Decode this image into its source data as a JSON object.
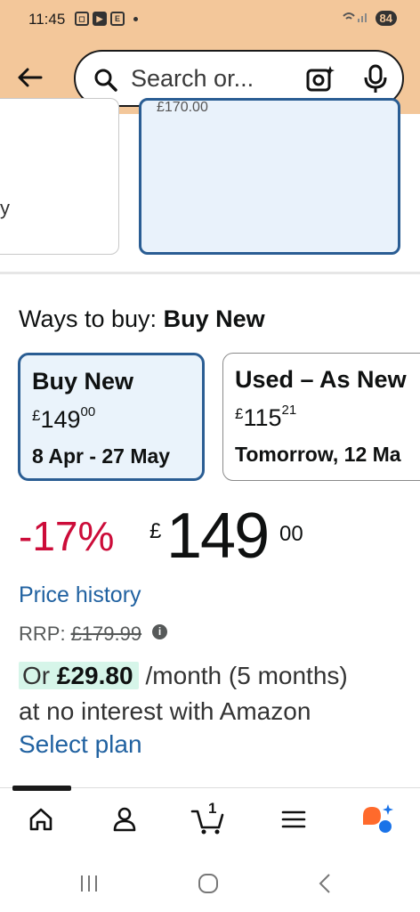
{
  "status_bar": {
    "time": "11:45",
    "icons": [
      "screenshot-icon",
      "youtube-icon",
      "e-app-icon"
    ],
    "battery": "84"
  },
  "header": {
    "search": {
      "placeholder": "Search or..."
    }
  },
  "carousel": {
    "left_card_fragment": "y",
    "right_card_fragment": "£170.00"
  },
  "ways_to_buy": {
    "label": "Ways to buy:",
    "selected": "Buy New",
    "options": [
      {
        "name": "Buy New",
        "currency": "£",
        "price_whole": "149",
        "price_fraction": "00",
        "delivery": "8 Apr - 27 May"
      },
      {
        "name": "Used – As New",
        "currency": "£",
        "price_whole": "115",
        "price_fraction": "21",
        "delivery": "Tomorrow, 12 Ma"
      }
    ]
  },
  "price": {
    "discount": "-17%",
    "currency": "£",
    "whole": "149",
    "fraction": "00",
    "price_history_link": "Price history",
    "rrp_label": "RRP:",
    "rrp_value": "£179.99",
    "monthly_prefix": "Or ",
    "monthly_amount": "£29.80",
    "monthly_suffix": "/month (5 months)",
    "interest_text": "at no interest with Amazon",
    "select_plan_link": "Select plan"
  },
  "bottom_nav": {
    "items": [
      "home-icon",
      "account-icon",
      "cart-icon",
      "menu-icon",
      "rufus-icon"
    ],
    "cart_count": "1"
  },
  "colors": {
    "header_bg": "#f3c79a",
    "selected_border": "#2a5d93",
    "discount_red": "#cc0c39",
    "link_blue": "#2162a1",
    "installment_highlight": "#d6f5e9",
    "rufus_orange": "#ff6a2c",
    "rufus_blue": "#1a73e8"
  }
}
